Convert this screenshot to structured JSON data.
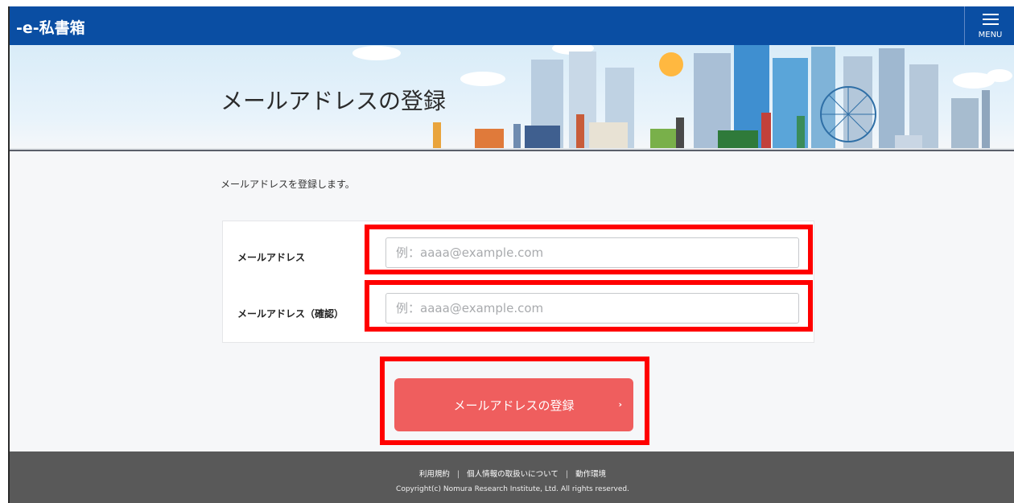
{
  "header": {
    "logo": "-e-私書箱",
    "menu_label": "MENU"
  },
  "banner": {
    "title": "メールアドレスの登録"
  },
  "main": {
    "intro": "メールアドレスを登録します。",
    "form": {
      "email_label": "メールアドレス",
      "email_placeholder": "例：aaaa@example.com",
      "email_confirm_label": "メールアドレス（確認）",
      "email_confirm_placeholder": "例：aaaa@example.com"
    },
    "submit_label": "メールアドレスの登録",
    "submit_arrow": "›"
  },
  "footer": {
    "links": [
      "利用規約",
      "個人情報の取扱いについて",
      "動作環境"
    ],
    "separator": "|",
    "copyright": "Copyright(c) Nomura Research Institute, Ltd. All rights reserved."
  },
  "colors": {
    "header_bg": "#0a4ea3",
    "submit_bg": "#ef5e5e",
    "highlight": "#ff0000",
    "footer_bg": "#595959"
  }
}
